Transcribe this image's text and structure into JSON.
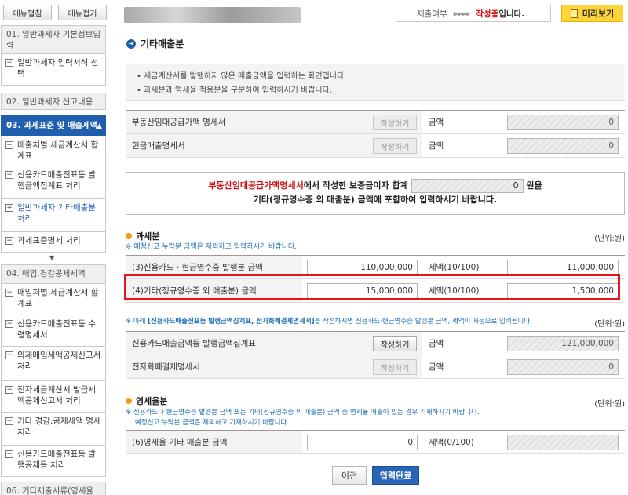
{
  "sidebar": {
    "expand_label": "메뉴펼침",
    "collapse_label": "메뉴접기",
    "sec1": "01. 일반과세자 기본정보입력",
    "sec1_item1": "일반과세자 입력서식 선택",
    "sec2": "02. 일반과세자 신고내용",
    "sec3": "03. 과세표준 및 매출세액",
    "sec3_item1": "매출처별 세금계산서 합계표",
    "sec3_item2": "신용카드매출전표등 발행금액집계표 처리",
    "sec3_item3": "일반과세자 기타매출분 처리",
    "sec3_item4": "과세표준명세 처리",
    "sec4": "04. 매입.경감공제세액",
    "sec4_item1": "매입처별 세금계산서 합계표",
    "sec4_item2": "신용카드매출전표등 수령명세서",
    "sec4_item3": "의제매입세액공제신고서 처리",
    "sec4_item4": "전자세금계산서 발급세액공제신고서 처리",
    "sec4_item5": "기타 경감.공제세액 명세 처리",
    "sec4_item6": "신용카드매출전표등 발행공제등 처리",
    "sec6": "06. 기타제출서류(영세율"
  },
  "header": {
    "status_label": "제출여부",
    "status_arrows": "▶▶▶▶",
    "status_value": "작성중",
    "status_suffix": "입니다.",
    "preview_label": "미리보기"
  },
  "page_title": "기타매출분",
  "notice": {
    "line1": "• 세금계산서를 발행하지 않은 매출금액을 입력하는 화면입니다.",
    "line2": "• 과세분과 영세율 적용분을 구분하여 입력하시기 바랍니다."
  },
  "top_table": {
    "row1_label": "부동산임대공급가액 명세서",
    "row1_btn": "작성하기",
    "row1_amount_label": "금액",
    "row1_amount": "0",
    "row2_label": "현금매출명세서",
    "row2_btn": "작성하기",
    "row2_amount_label": "금액",
    "row2_amount": "0"
  },
  "infobox": {
    "red_text": "부동산임대공급가액명세서",
    "text1": "에서 작성한 보증금이자 합계",
    "deposit_value": "0",
    "text2": " 원을",
    "line2": "기타(정규영수증 외 매출분) 금액에 포함하여 입력하시기 바랍니다."
  },
  "taxable": {
    "title": "과세분",
    "unit": "(단위:원)",
    "note": "※ 예정신고 누락분 금액은 제외하고 입력하시기 바랍니다.",
    "row3_label": "(3)신용카드 · 현금영수증 발행분 금액",
    "row3_amount": "110,000,000",
    "row3_tax_label": "세액(10/100)",
    "row3_tax": "11,000,000",
    "row4_label": "(4)기타(정규영수증 외 매출분) 금액",
    "row4_amount": "15,000,000",
    "row4_tax_label": "세액(10/100)",
    "row4_tax": "1,500,000"
  },
  "card_section": {
    "note_prefix": "※ 아래 ",
    "note_bold": "[신용카드매출전표등 발행금액집계표, 전자화폐결제명세서]",
    "note_suffix": "를 작성하시면 신용카드·현금영수증 발행분 금액, 세액이 자동으로 입력됩니다.",
    "unit": "(단위:원)",
    "row1_label": "신용카드매출금액등 발행금액집계표",
    "row1_btn": "작성하기",
    "row1_amount_label": "금액",
    "row1_amount": "121,000,000",
    "row2_label": "전자화폐결제명세서",
    "row2_btn": "작성하기",
    "row2_amount_label": "금액",
    "row2_amount": "0"
  },
  "zero_rate": {
    "title": "영세율분",
    "unit": "(단위:원)",
    "note1": "※ 신용카드나 현금영수증 발행분 금액 또는 기타(정규영수증 외 매출분) 금액 중 영세율 매출이 있는 경우 기재하시기 바랍니다.",
    "note2": "예정신고 누락분 금액은 제외하고 기재하시기 바랍니다.",
    "row6_label": "(6)영세율 기타 매출분 금액",
    "row6_amount": "0",
    "row6_tax_label": "세액(0/100)",
    "row6_tax": ""
  },
  "buttons": {
    "prev": "이전",
    "done": "입력완료"
  },
  "colors": {
    "accent": "#1f5fae",
    "status_red": "#d01010",
    "preview_yellow": "#ffd43b",
    "highlight": "#e4161d"
  }
}
